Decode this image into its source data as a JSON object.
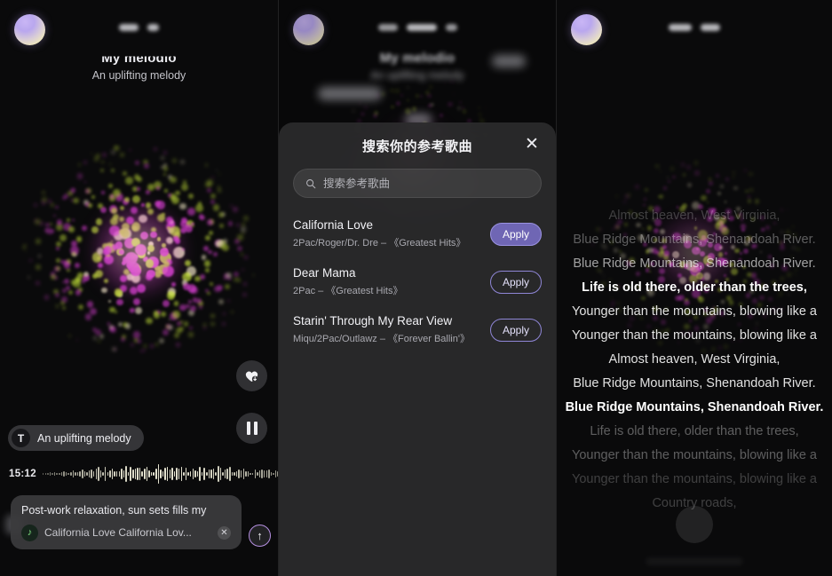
{
  "app": {
    "track_title": "My melodio",
    "track_subtitle": "An uplifting melody",
    "avatar_name": "user-avatar-orb"
  },
  "left_panel": {
    "text_chip": {
      "badge": "T",
      "label": "An uplifting melody"
    },
    "player": {
      "elapsed_time": "15:12",
      "loop_icon": "∞",
      "heart_download_icon": "♥",
      "pause_icon": "pause"
    },
    "prompt": {
      "text": "Post-work relaxation, sun sets fills my",
      "reference_track": "California Love California Lov...",
      "note_icon": "♪",
      "clear_label": "✕",
      "send_label": "↑"
    }
  },
  "modal": {
    "title": "搜索你的参考歌曲",
    "close_label": "✕",
    "search": {
      "placeholder": "搜索参考歌曲",
      "value": "",
      "icon": "search-icon"
    },
    "apply_label": "Apply",
    "songs": [
      {
        "name": "California Love",
        "artist": "2Pac/Roger/Dr. Dre – 《Greatest Hits》",
        "applied": true
      },
      {
        "name": "Dear Mama",
        "artist": "2Pac – 《Greatest Hits》",
        "applied": false
      },
      {
        "name": "Starin' Through My Rear View",
        "artist": "Miqu/2Pac/Outlawz – 《Forever Ballin'》",
        "applied": false
      }
    ]
  },
  "lyrics_panel": {
    "lines": [
      "Almost heaven, West Virginia,",
      "Blue Ridge Mountains, Shenandoah River.",
      "Blue Ridge Mountains, Shenandoah River.",
      "Life is old there, older than the trees,",
      "Younger than the mountains, blowing like a",
      "Younger than the mountains, blowing like a",
      "Almost heaven, West Virginia,",
      "Blue Ridge Mountains, Shenandoah River.",
      "Blue Ridge Mountains, Shenandoah River.",
      "Life is old there, older than the trees,",
      "Younger than the mountains, blowing like a",
      "Younger than the mountains, blowing like a",
      "Country roads,"
    ]
  },
  "colors": {
    "accent_purple": "#6f66b4",
    "accent_border": "#8f86d6",
    "panel_bg": "#0a0a0b",
    "modal_bg": "#2c2c2e",
    "viz_magenta": "#d83fd2",
    "viz_lime": "#c3e03a",
    "note_green": "#7fe081"
  }
}
